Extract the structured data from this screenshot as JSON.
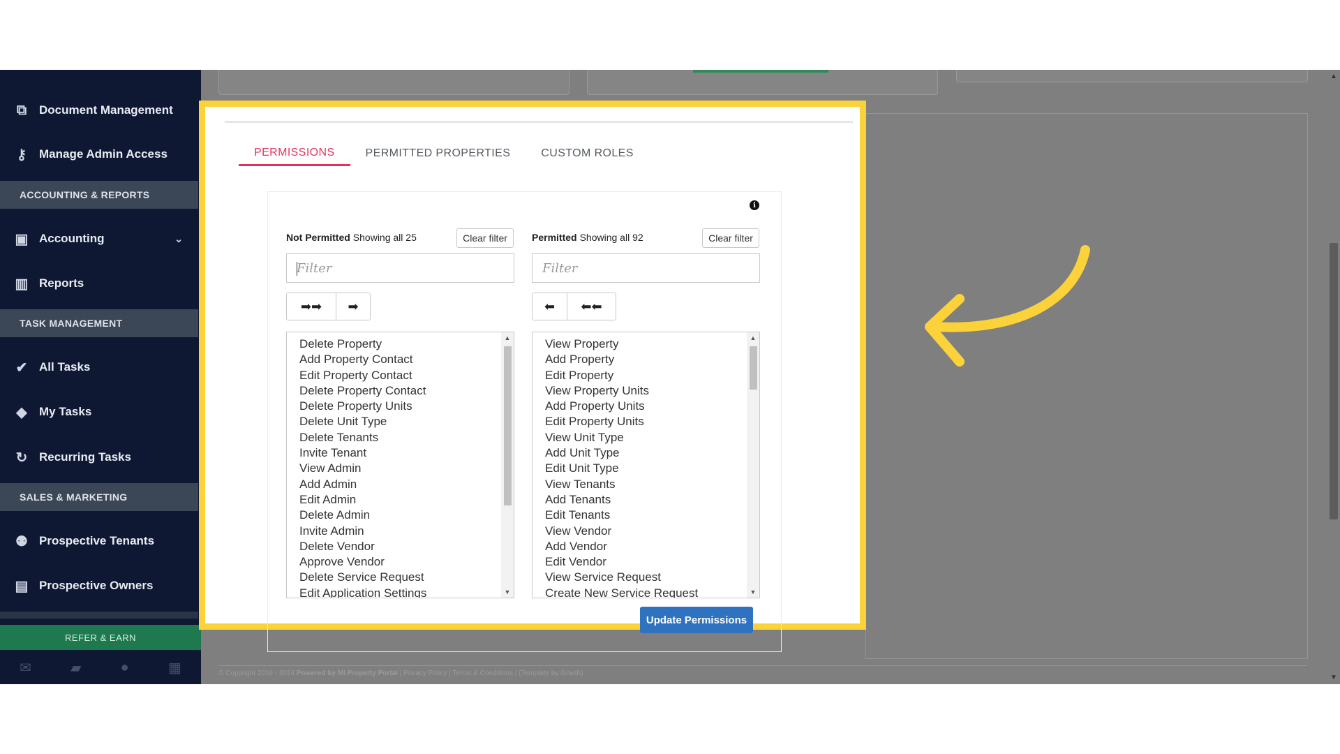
{
  "sidebar": {
    "items": [
      {
        "label": "Document Management",
        "icon": "documents-icon"
      },
      {
        "label": "Manage Admin Access",
        "icon": "key-icon"
      },
      {
        "label": "Accounting",
        "icon": "money-icon"
      },
      {
        "label": "Reports",
        "icon": "bar-chart-icon"
      },
      {
        "label": "All Tasks",
        "icon": "check-icon"
      },
      {
        "label": "My Tasks",
        "icon": "tag-icon"
      },
      {
        "label": "Recurring Tasks",
        "icon": "refresh-icon"
      },
      {
        "label": "Prospective Tenants",
        "icon": "users-icon"
      },
      {
        "label": "Prospective Owners",
        "icon": "id-card-icon"
      }
    ],
    "sections": [
      "ACCOUNTING & REPORTS",
      "TASK MANAGEMENT",
      "SALES & MARKETING"
    ],
    "refer_label": "REFER & EARN"
  },
  "tabs": [
    "PERMISSIONS",
    "PERMITTED PROPERTIES",
    "CUSTOM ROLES"
  ],
  "not_permitted": {
    "title": "Not Permitted",
    "showing": "Showing all 25",
    "clear_label": "Clear filter",
    "filter_placeholder": "Filter",
    "items": [
      "Delete Property",
      "Add Property Contact",
      "Edit Property Contact",
      "Delete Property Contact",
      "Delete Property Units",
      "Delete Unit Type",
      "Delete Tenants",
      "Invite Tenant",
      "View Admin",
      "Add Admin",
      "Edit Admin",
      "Delete Admin",
      "Invite Admin",
      "Delete Vendor",
      "Approve Vendor",
      "Delete Service Request",
      "Edit Application Settings"
    ]
  },
  "permitted": {
    "title": "Permitted",
    "showing": "Showing all 92",
    "clear_label": "Clear filter",
    "filter_placeholder": "Filter",
    "items": [
      "View Property",
      "Add Property",
      "Edit Property",
      "View Property Units",
      "Add Property Units",
      "Edit Property Units",
      "View Unit Type",
      "Add Unit Type",
      "Edit Unit Type",
      "View Tenants",
      "Add Tenants",
      "Edit Tenants",
      "View Vendor",
      "Add Vendor",
      "Edit Vendor",
      "View Service Request",
      "Create New Service Request"
    ]
  },
  "update_label": "Update Permissions",
  "footer": {
    "copyright": "© Copyright 2016 - 2024",
    "powered": "Powered by MI Property Portal",
    "links": "| Privacy Policy | Terms & Conditions |",
    "template": "(Template by Gowth)"
  },
  "colors": {
    "accent_tab": "#e0345f",
    "primary_button": "#2f73c0",
    "highlight": "#fcd23a",
    "sidebar": "#0f1833"
  }
}
